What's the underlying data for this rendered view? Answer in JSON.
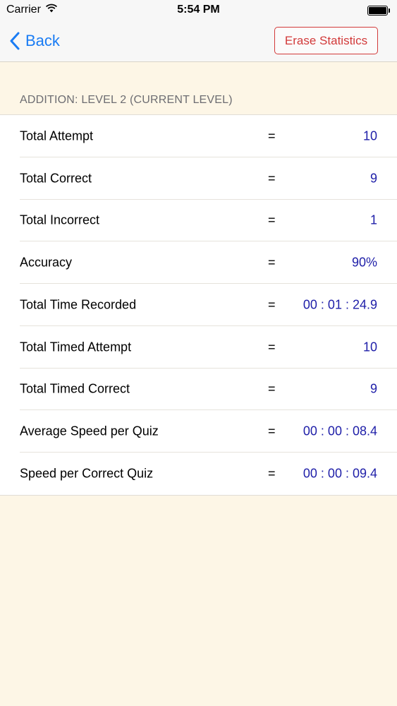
{
  "status": {
    "carrier": "Carrier",
    "time": "5:54 PM"
  },
  "nav": {
    "back_label": "Back",
    "erase_label": "Erase Statistics"
  },
  "section": {
    "title": "ADDITION: LEVEL 2 (CURRENT LEVEL)"
  },
  "stats": [
    {
      "label": "Total Attempt",
      "eq": "=",
      "value": "10"
    },
    {
      "label": "Total Correct",
      "eq": "=",
      "value": "9"
    },
    {
      "label": "Total Incorrect",
      "eq": "=",
      "value": "1"
    },
    {
      "label": "Accuracy",
      "eq": "=",
      "value": "90%"
    },
    {
      "label": "Total Time Recorded",
      "eq": "=",
      "value": "00 : 01 : 24.9"
    },
    {
      "label": "Total Timed Attempt",
      "eq": "=",
      "value": "10"
    },
    {
      "label": "Total Timed Correct",
      "eq": "=",
      "value": "9"
    },
    {
      "label": "Average Speed per Quiz",
      "eq": "=",
      "value": "00 : 00 : 08.4"
    },
    {
      "label": "Speed per Correct Quiz",
      "eq": "=",
      "value": "00 : 00 : 09.4"
    }
  ],
  "colors": {
    "accent": "#1a7cf4",
    "destructive": "#d23a3a",
    "value": "#1e1ea8",
    "background": "#fdf6e6"
  }
}
